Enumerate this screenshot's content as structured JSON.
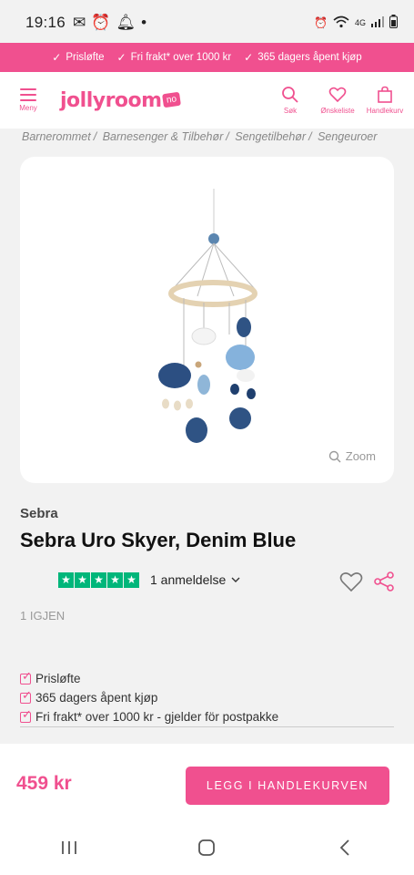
{
  "status_bar": {
    "time": "19:16",
    "network": "4G",
    "network_sub": "TALE1"
  },
  "promo": {
    "items": [
      "Prisløfte",
      "Fri frakt* over 1000 kr",
      "365 dagers åpent kjøp"
    ]
  },
  "header": {
    "menu_label": "Meny",
    "logo_text": "jollyroom",
    "logo_tld": "no",
    "search_label": "Søk",
    "wishlist_label": "Ønskeliste",
    "cart_label": "Handlekurv"
  },
  "breadcrumb": [
    "Barnerommet",
    "Barnesenger & Tilbehør",
    "Sengetilbehør",
    "Sengeuroer"
  ],
  "product": {
    "zoom_label": "Zoom",
    "brand": "Sebra",
    "title": "Sebra Uro Skyer, Denim Blue",
    "rating_stars": 5,
    "reviews": "1 anmeldelse",
    "stock": "1 IGJEN",
    "benefits": [
      "Prisløfte",
      "365 dagers åpent kjøp",
      "Fri frakt* over 1000 kr - gjelder för postpakke"
    ],
    "price": "459 kr",
    "cart_button": "LEGG I HANDLEKURVEN"
  },
  "colors": {
    "brand": "#f0508f",
    "trustpilot": "#00b67a"
  }
}
